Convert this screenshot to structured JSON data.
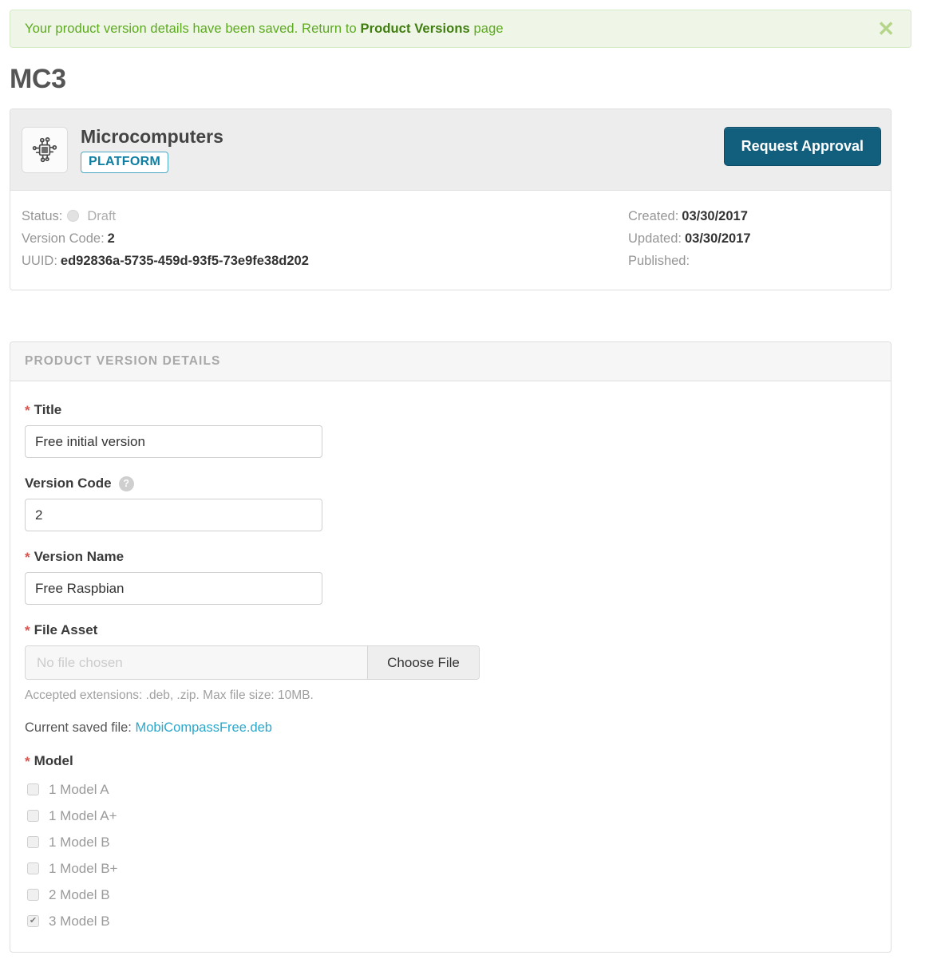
{
  "alert": {
    "text_before": "Your product version details have been saved. Return to ",
    "link_label": "Product Versions",
    "text_after": " page",
    "close_icon": "close-icon",
    "close_glyph": "✕",
    "bg_color": "#eff5e7",
    "border_color": "#d6e9c6",
    "text_color": "#5cab1e"
  },
  "page": {
    "title": "MC3"
  },
  "summary": {
    "product_icon": "microchip-icon",
    "product_name": "Microcomputers",
    "badge": "PLATFORM",
    "badge_color": "#0e7fa3",
    "request_button": "Request Approval",
    "request_button_color": "#115e7d",
    "left_meta": [
      {
        "label": "Status:",
        "value": "Draft",
        "has_dot": true
      },
      {
        "label": "Version Code:",
        "value": "2",
        "has_dot": false
      },
      {
        "label": "UUID:",
        "value": "ed92836a-5735-459d-93f5-73e9fe38d202",
        "has_dot": false
      }
    ],
    "right_meta": [
      {
        "label": "Created:",
        "value": "03/30/2017"
      },
      {
        "label": "Updated:",
        "value": "03/30/2017"
      },
      {
        "label": "Published:",
        "value": ""
      }
    ]
  },
  "details_panel": {
    "header": "PRODUCT VERSION DETAILS",
    "fields": {
      "title": {
        "label": "Title",
        "required": true,
        "value": "Free initial version"
      },
      "version_code": {
        "label": "Version Code",
        "required": false,
        "has_help": true,
        "help_glyph": "?",
        "value": "2"
      },
      "version_name": {
        "label": "Version Name",
        "required": true,
        "value": "Free Raspbian"
      },
      "file_asset": {
        "label": "File Asset",
        "required": true,
        "placeholder": "No file chosen",
        "button_label": "Choose File",
        "help_text": "Accepted extensions: .deb, .zip. Max file size: 10MB.",
        "saved_prefix": "Current saved file: ",
        "saved_file_name": "MobiCompassFree.deb",
        "saved_file_color": "#29a8cc"
      },
      "model": {
        "label": "Model",
        "required": true,
        "options": [
          {
            "label": "1 Model A",
            "checked": false
          },
          {
            "label": "1 Model A+",
            "checked": false
          },
          {
            "label": "1 Model B",
            "checked": false
          },
          {
            "label": "1 Model B+",
            "checked": false
          },
          {
            "label": "2 Model B",
            "checked": false
          },
          {
            "label": "3 Model B",
            "checked": true
          }
        ]
      }
    }
  }
}
